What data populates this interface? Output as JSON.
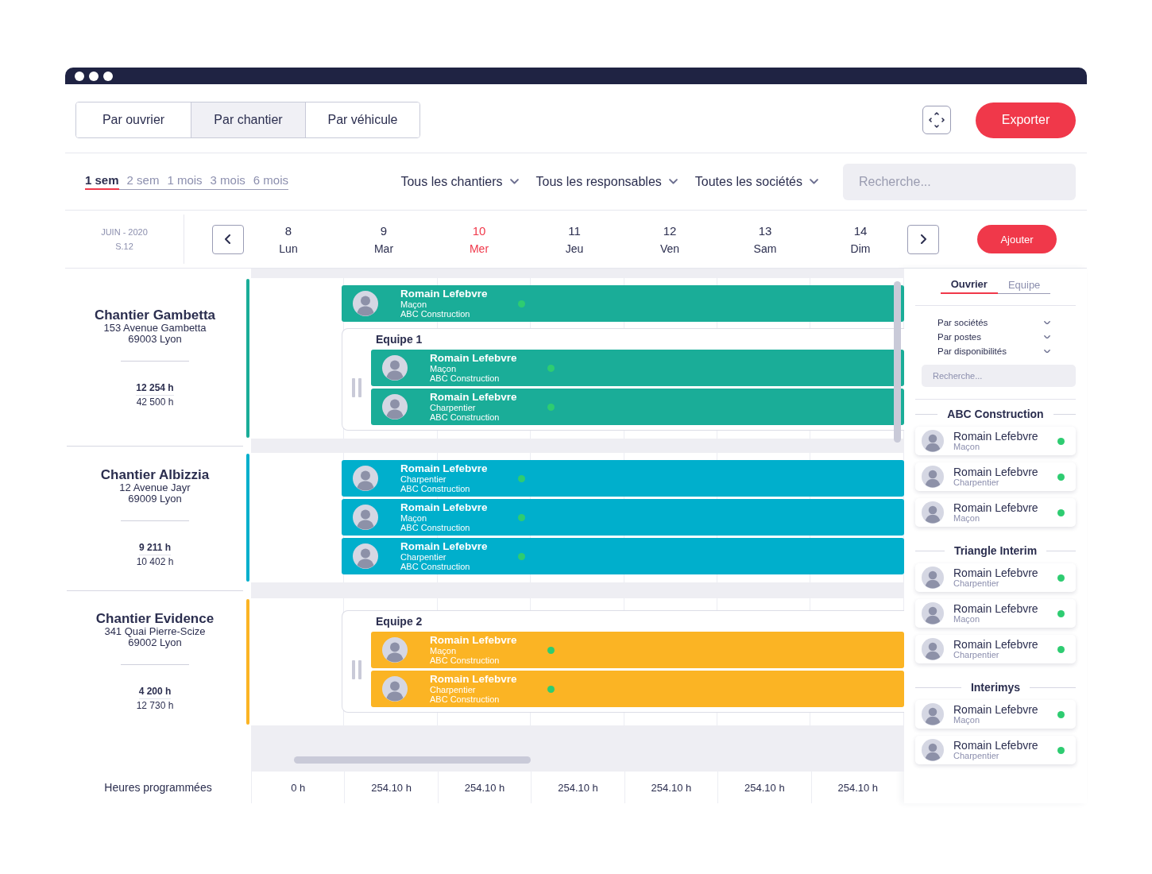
{
  "view_tabs": [
    {
      "label": "Par ouvrier",
      "selected": false
    },
    {
      "label": "Par chantier",
      "selected": true
    },
    {
      "label": "Par véhicule",
      "selected": false
    }
  ],
  "export_button": "Exporter",
  "periods": [
    {
      "label": "1 sem",
      "selected": true
    },
    {
      "label": "2 sem",
      "selected": false
    },
    {
      "label": "1 mois",
      "selected": false
    },
    {
      "label": "3 mois",
      "selected": false
    },
    {
      "label": "6 mois",
      "selected": false
    }
  ],
  "filters": [
    "Tous les chantiers",
    "Tous les responsables",
    "Toutes les sociétés"
  ],
  "search": {
    "placeholder": "Recherche..."
  },
  "calendar": {
    "month": "JUIN - 2020",
    "week": "S.12",
    "add_button": "Ajouter",
    "days": [
      {
        "number": "8",
        "name": "Lun",
        "today": false
      },
      {
        "number": "9",
        "name": "Mar",
        "today": false
      },
      {
        "number": "10",
        "name": "Mer",
        "today": true
      },
      {
        "number": "11",
        "name": "Jeu",
        "today": false
      },
      {
        "number": "12",
        "name": "Ven",
        "today": false
      },
      {
        "number": "13",
        "name": "Sam",
        "today": false
      },
      {
        "number": "14",
        "name": "Dim",
        "today": false
      }
    ]
  },
  "sites": [
    {
      "name": "Chantier Gambetta",
      "address": "153 Avenue Gambetta",
      "city": "69003 Lyon",
      "hours_planned": "12 254 h",
      "hours_total": "42 500 h",
      "color": "#1aad98",
      "assignments": [
        {
          "kind": "worker",
          "name": "Romain Lefebvre",
          "role": "Maçon",
          "company": "ABC Construction",
          "available": true
        },
        {
          "kind": "team",
          "name": "Equipe 1",
          "members": [
            {
              "name": "Romain Lefebvre",
              "role": "Maçon",
              "company": "ABC Construction",
              "available": true
            },
            {
              "name": "Romain Lefebvre",
              "role": "Charpentier",
              "company": "ABC Construction",
              "available": true
            }
          ]
        }
      ]
    },
    {
      "name": "Chantier Albizzia",
      "address": "12 Avenue Jayr",
      "city": "69009 Lyon",
      "hours_planned": "9 211 h",
      "hours_total": "10 402 h",
      "color": "#00afcc",
      "assignments": [
        {
          "kind": "worker",
          "name": "Romain Lefebvre",
          "role": "Charpentier",
          "company": "ABC Construction",
          "available": true
        },
        {
          "kind": "worker",
          "name": "Romain Lefebvre",
          "role": "Maçon",
          "company": "ABC Construction",
          "available": true
        },
        {
          "kind": "worker",
          "name": "Romain Lefebvre",
          "role": "Charpentier",
          "company": "ABC Construction",
          "available": true
        }
      ]
    },
    {
      "name": "Chantier Evidence",
      "address": "341 Quai Pierre-Scize",
      "city": "69002 Lyon",
      "hours_planned": "4 200 h",
      "hours_total": "12 730 h",
      "color": "#fbb424",
      "assignments": [
        {
          "kind": "team",
          "name": "Equipe 2",
          "members": [
            {
              "name": "Romain Lefebvre",
              "role": "Maçon",
              "company": "ABC Construction",
              "available": true
            },
            {
              "name": "Romain Lefebvre",
              "role": "Charpentier",
              "company": "ABC Construction",
              "available": true
            }
          ]
        }
      ]
    }
  ],
  "totals": {
    "label": "Heures programmées",
    "values": [
      "0 h",
      "254.10 h",
      "254.10 h",
      "254.10 h",
      "254.10 h",
      "254.10 h",
      "254.10 h"
    ]
  },
  "sidebar": {
    "tabs": [
      {
        "label": "Ouvrier",
        "selected": true
      },
      {
        "label": "Equipe",
        "selected": false
      }
    ],
    "filters": [
      "Par sociétés",
      "Par postes",
      "Par disponibilités"
    ],
    "search": {
      "placeholder": "Recherche..."
    },
    "groups": [
      {
        "name": "ABC Construction",
        "workers": [
          {
            "name": "Romain Lefebvre",
            "role": "Maçon",
            "available": true
          },
          {
            "name": "Romain Lefebvre",
            "role": "Charpentier",
            "available": true
          },
          {
            "name": "Romain Lefebvre",
            "role": "Maçon",
            "available": true
          }
        ]
      },
      {
        "name": "Triangle Interim",
        "workers": [
          {
            "name": "Romain Lefebvre",
            "role": "Charpentier",
            "available": true
          },
          {
            "name": "Romain Lefebvre",
            "role": "Maçon",
            "available": true
          },
          {
            "name": "Romain Lefebvre",
            "role": "Charpentier",
            "available": true
          }
        ]
      },
      {
        "name": "Interimys",
        "workers": [
          {
            "name": "Romain Lefebvre",
            "role": "Maçon",
            "available": true
          },
          {
            "name": "Romain Lefebvre",
            "role": "Charpentier",
            "available": true
          }
        ]
      }
    ]
  }
}
